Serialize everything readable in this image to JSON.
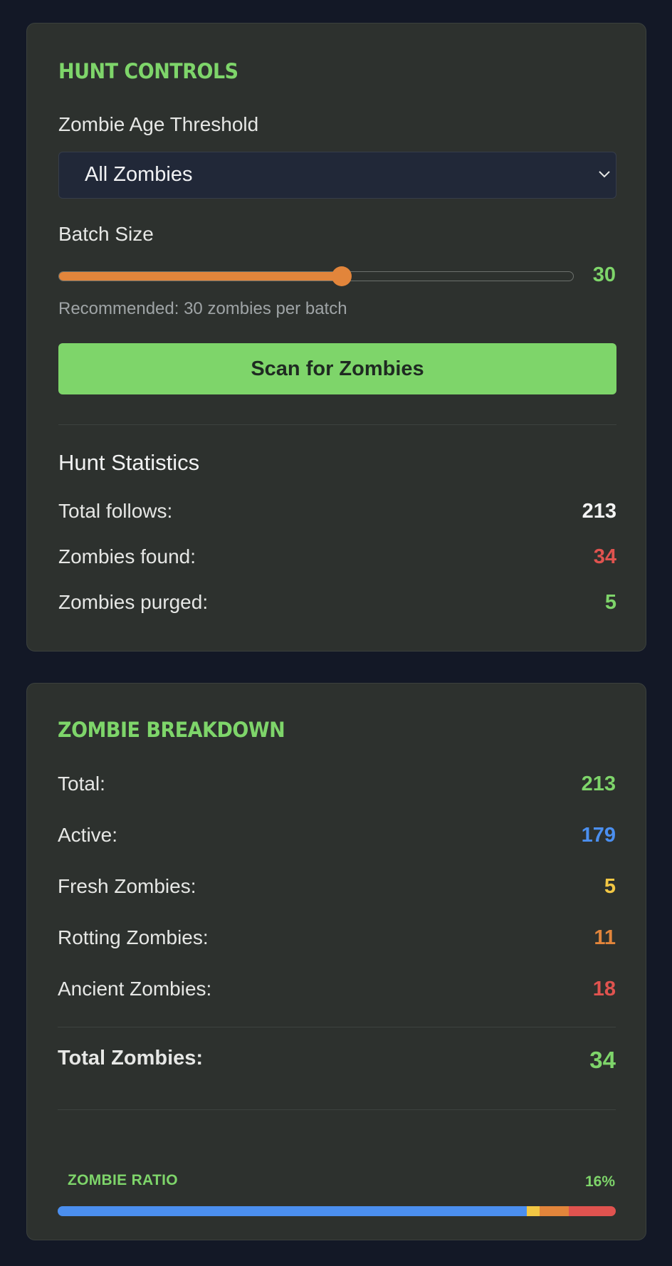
{
  "hunt_controls": {
    "heading": "HUNT CONTROLS",
    "age_label": "Zombie Age Threshold",
    "age_selected": "All Zombies",
    "batch_label": "Batch Size",
    "batch_value": "30",
    "batch_fraction": 0.55,
    "batch_hint": "Recommended: 30 zombies per batch",
    "scan_button": "Scan for Zombies",
    "stats_title": "Hunt Statistics",
    "stats": [
      {
        "label": "Total follows:",
        "value": "213",
        "color": "#f4f4f4"
      },
      {
        "label": "Zombies found:",
        "value": "34",
        "color": "#e0534f"
      },
      {
        "label": "Zombies purged:",
        "value": "5",
        "color": "#7ed56a"
      }
    ]
  },
  "breakdown": {
    "heading": "ZOMBIE BREAKDOWN",
    "rows": [
      {
        "label": "Total:",
        "value": "213",
        "color": "#7ed56a"
      },
      {
        "label": "Active:",
        "value": "179",
        "color": "#4b8fef"
      },
      {
        "label": "Fresh Zombies:",
        "value": "5",
        "color": "#f2c744"
      },
      {
        "label": "Rotting Zombies:",
        "value": "11",
        "color": "#e2853b"
      },
      {
        "label": "Ancient Zombies:",
        "value": "18",
        "color": "#e0534f"
      }
    ],
    "total_label": "Total Zombies:",
    "total_value": "34",
    "ratio_label": "ZOMBIE RATIO",
    "ratio_value": "16%",
    "ratio_segments": [
      {
        "name": "active",
        "count": 179,
        "color": "#4b8fef"
      },
      {
        "name": "fresh",
        "count": 5,
        "color": "#f2c744"
      },
      {
        "name": "rotting",
        "count": 11,
        "color": "#e2853b"
      },
      {
        "name": "ancient",
        "count": 18,
        "color": "#e0534f"
      }
    ],
    "ratio_total": 213
  }
}
